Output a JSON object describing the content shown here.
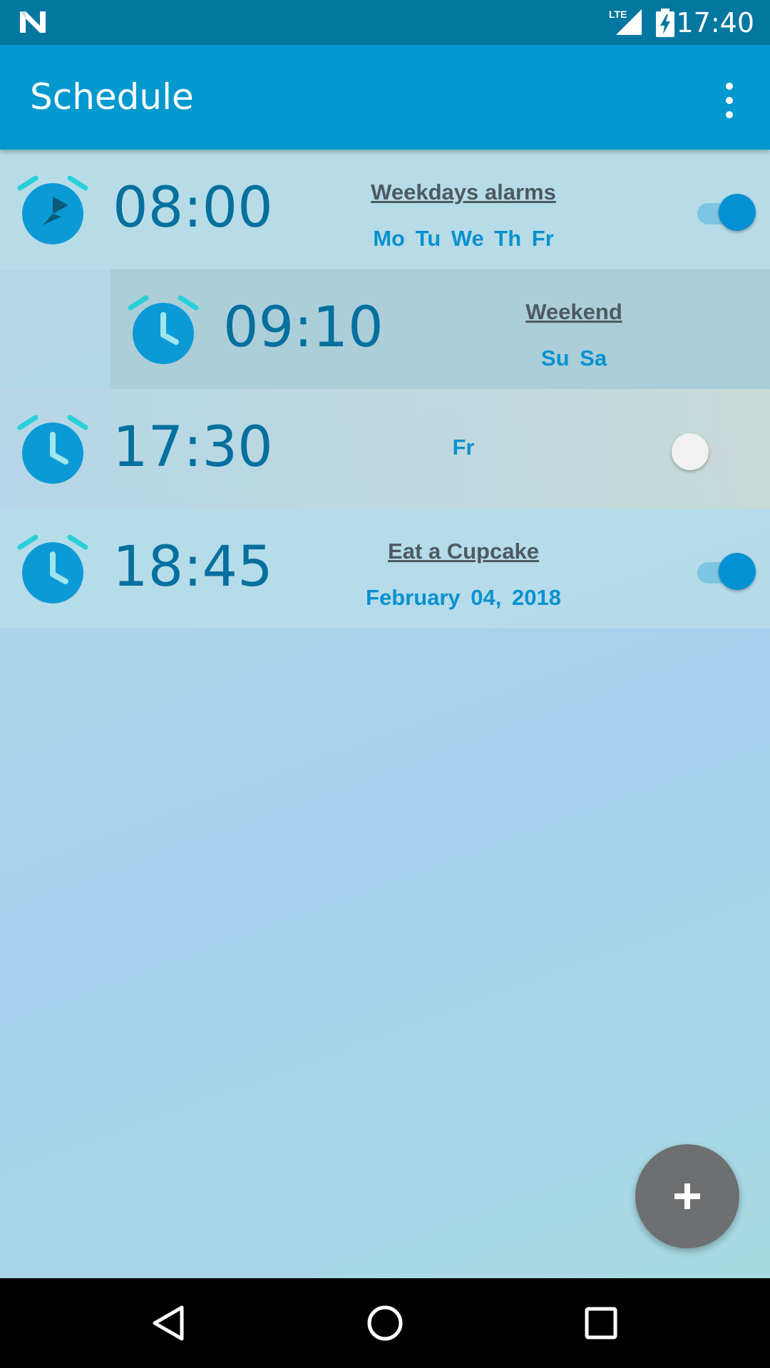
{
  "status_bar": {
    "network_label": "LTE",
    "time": "17:40"
  },
  "app_bar": {
    "title": "Schedule",
    "overflow_icon": "more-vert-icon"
  },
  "alarms": [
    {
      "time": "08:00",
      "label": "Weekdays alarms",
      "days": "Mo  Tu  We  Th  Fr",
      "enabled": true
    },
    {
      "time": "09:10",
      "label": "Weekend",
      "days": "Su  Sa",
      "enabled": null
    },
    {
      "time": "17:30",
      "label": "",
      "days": "Fr",
      "enabled": false
    },
    {
      "time": "18:45",
      "label": "Eat a Cupcake",
      "days": "February 04, 2018",
      "enabled": true
    }
  ],
  "fab": {
    "icon": "plus-icon"
  },
  "nav_bar": {
    "icons": [
      "back-icon",
      "home-icon",
      "recents-icon"
    ]
  },
  "colors": {
    "status_bar": "#0477a0",
    "app_bar": "#0399cf",
    "accent": "#0391d4",
    "time_text": "#05709e",
    "fab": "#6d6f70"
  }
}
